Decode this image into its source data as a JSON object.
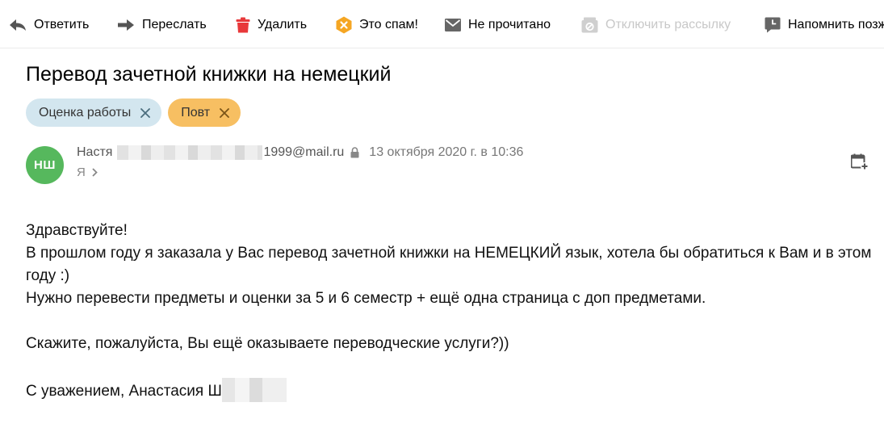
{
  "toolbar": {
    "reply": "Ответить",
    "forward": "Переслать",
    "delete": "Удалить",
    "spam": "Это спам!",
    "unread": "Не прочитано",
    "unsubscribe": "Отключить рассылку",
    "remind": "Напомнить позже"
  },
  "message": {
    "subject": "Перевод зачетной книжки на немецкий",
    "labels": [
      "Оценка работы",
      "Повт"
    ],
    "sender": {
      "initials": "НШ",
      "name": "Настя",
      "email_tail": "1999@mail.ru",
      "date": "13 октября 2020 г. в 10:36",
      "to": "Я"
    },
    "body": {
      "greeting": "Здравствуйте!",
      "line1": "В прошлом году я заказала у Вас перевод зачетной книжки на НЕМЕЦКИЙ язык, хотела бы обратиться к Вам и в этом году :)",
      "line2": "Нужно перевести предметы и оценки за 5 и 6 семестр + ещё одна страница с доп предметами.",
      "question": "Скажите, пожалуйста, Вы ещё оказываете переводческие услуги?))",
      "signature": "С уважением, Анастасия Ш"
    }
  },
  "colors": {
    "label_blue": "#d3e6ef",
    "label_orange": "#f7bf62",
    "avatar": "#56b85d",
    "delete_icon": "#e8383a",
    "spam_icon": "#f5a623"
  }
}
